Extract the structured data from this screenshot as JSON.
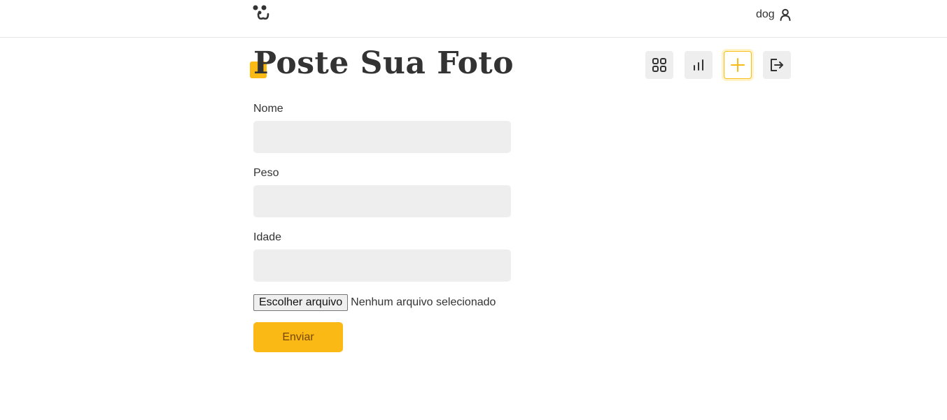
{
  "header": {
    "username": "dog",
    "logo_icon": "dog-face-icon",
    "user_icon": "user-icon"
  },
  "page": {
    "title": "Poste Sua Foto",
    "accent_color": "#fbb915"
  },
  "account_nav": [
    {
      "icon": "grid-icon",
      "active": false
    },
    {
      "icon": "stats-icon",
      "active": false
    },
    {
      "icon": "plus-icon",
      "active": true
    },
    {
      "icon": "logout-icon",
      "active": false
    }
  ],
  "form": {
    "fields": [
      {
        "label": "Nome",
        "value": ""
      },
      {
        "label": "Peso",
        "value": ""
      },
      {
        "label": "Idade",
        "value": ""
      }
    ],
    "file_button_label": "Escolher arquivo",
    "file_status": "Nenhum arquivo selecionado",
    "submit_label": "Enviar"
  },
  "colors": {
    "primary": "#fbb915",
    "primary_text": "#764701",
    "input_bg": "#eeeeee",
    "text": "#333333"
  }
}
